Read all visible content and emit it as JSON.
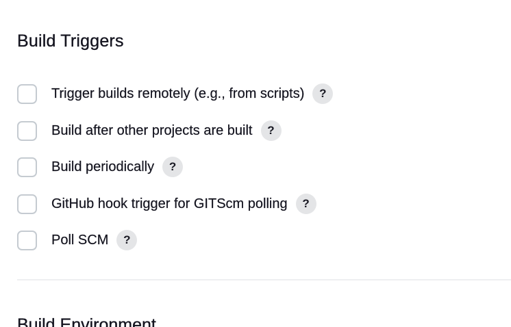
{
  "build_triggers": {
    "title": "Build Triggers",
    "options": [
      {
        "label": "Trigger builds remotely (e.g., from scripts)",
        "checked": false,
        "help": "?"
      },
      {
        "label": "Build after other projects are built",
        "checked": false,
        "help": "?"
      },
      {
        "label": "Build periodically",
        "checked": false,
        "help": "?"
      },
      {
        "label": "GitHub hook trigger for GITScm polling",
        "checked": false,
        "help": "?"
      },
      {
        "label": "Poll SCM",
        "checked": false,
        "help": "?"
      }
    ]
  },
  "build_environment": {
    "title": "Build Environment"
  },
  "colors": {
    "checkbox_border": "#c5cbd1",
    "help_bg": "#e4e5e7",
    "divider": "#eeeff1",
    "text": "#14141f"
  }
}
